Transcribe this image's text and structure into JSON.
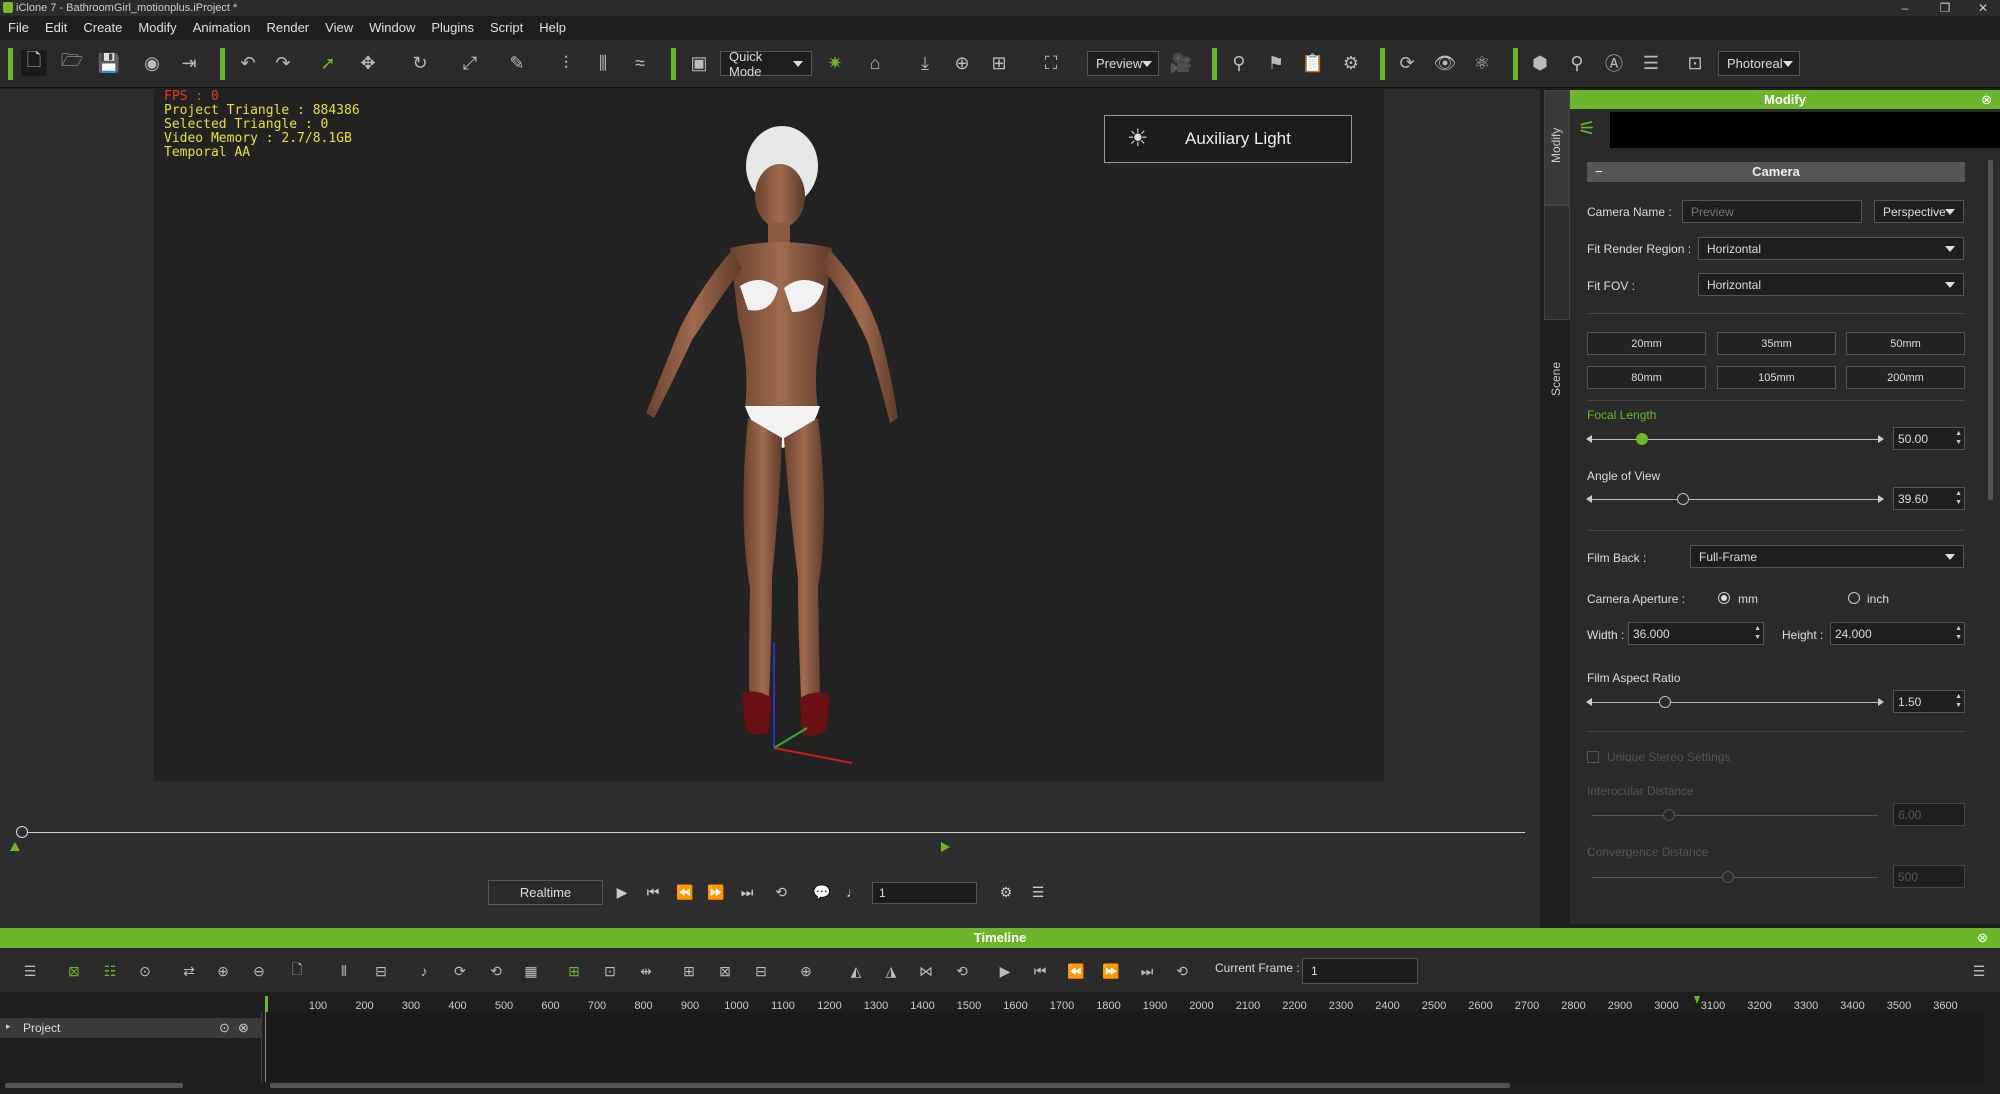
{
  "window": {
    "title": "iClone 7 - BathroomGirl_motionplus.iProject *"
  },
  "menu": [
    "File",
    "Edit",
    "Create",
    "Modify",
    "Animation",
    "Render",
    "View",
    "Window",
    "Plugins",
    "Script",
    "Help"
  ],
  "toolbar": {
    "mode": "Quick Mode",
    "preview": "Preview",
    "render_quality": "Photoreal"
  },
  "viewport": {
    "stats": {
      "fps": "FPS : 0",
      "triangles": "Project Triangle : 884386",
      "selected": "Selected Triangle : 0",
      "memory": "Video Memory : 2.7/8.1GB",
      "aa": "Temporal AA"
    },
    "aux_light": "Auxiliary Light"
  },
  "playback": {
    "realtime": "Realtime",
    "frame": "1"
  },
  "side_tabs": {
    "modify": "Modify",
    "scene": "Scene"
  },
  "modify": {
    "title": "Modify",
    "section": "Camera",
    "camera_name_label": "Camera Name :",
    "camera_name_placeholder": "Preview",
    "projection": "Perspective",
    "fit_render_label": "Fit Render Region :",
    "fit_render_value": "Horizontal",
    "fit_fov_label": "Fit FOV :",
    "fit_fov_value": "Horizontal",
    "lens_presets": [
      "20mm",
      "35mm",
      "50mm",
      "80mm",
      "105mm",
      "200mm"
    ],
    "focal_length_label": "Focal Length",
    "focal_length": "50.00",
    "angle_label": "Angle of View",
    "angle": "39.60",
    "film_back_label": "Film Back :",
    "film_back": "Full-Frame",
    "aperture_label": "Camera Aperture :",
    "aperture_mm": "mm",
    "aperture_inch": "inch",
    "width_label": "Width :",
    "width": "36.000",
    "height_label": "Height :",
    "height": "24.000",
    "aspect_label": "Film Aspect Ratio",
    "aspect": "1.50",
    "stereo_label": "Unique Stereo Settings",
    "interocular_label": "Interocular Distance",
    "interocular": "6.00",
    "convergence_label": "Convergence Distance",
    "convergence": "500"
  },
  "timeline": {
    "title": "Timeline",
    "current_frame_label": "Current Frame :",
    "current_frame": "1",
    "ruler": [
      "100",
      "200",
      "300",
      "400",
      "500",
      "600",
      "700",
      "800",
      "900",
      "1000",
      "1100",
      "1200",
      "1300",
      "1400",
      "1500",
      "1600",
      "1700",
      "1800",
      "1900",
      "2000",
      "2100",
      "2200",
      "2300",
      "2400",
      "2500",
      "2600",
      "2700",
      "2800",
      "2900",
      "3000",
      "3100",
      "3200",
      "3300",
      "3400",
      "3500",
      "3600"
    ],
    "track": "Project"
  },
  "colors": {
    "accent": "#6db52a",
    "stats": "#e8e03a",
    "fps": "#e23b2b"
  }
}
